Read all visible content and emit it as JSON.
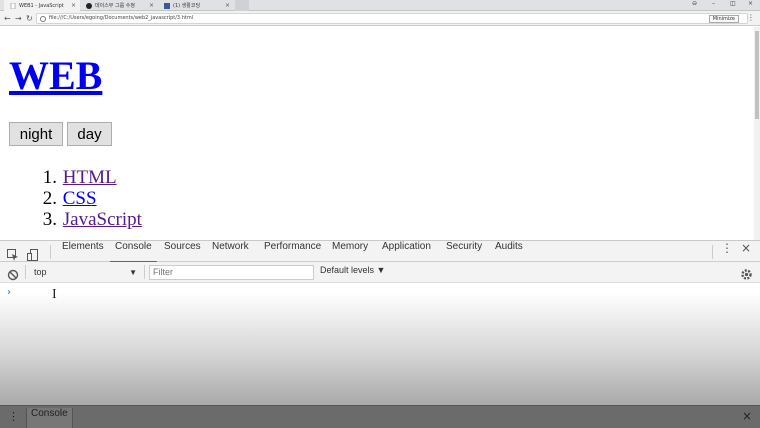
{
  "browser": {
    "tabs": [
      {
        "title": "WEB1 - JavaScript",
        "active": true
      },
      {
        "title": "데이스부 그룹 수정",
        "active": false
      },
      {
        "title": "(1) 생활코딩",
        "active": false
      },
      {
        "title": "",
        "active": false
      }
    ],
    "tab_close": "×",
    "window_controls": {
      "user": "⊖",
      "minimize": "–",
      "maximize": "◫",
      "close": "×"
    },
    "nav": {
      "back": "←",
      "forward": "→",
      "reload": "↻"
    },
    "url": "file:///C:/Users/egoing/Documents/web2_javascript/3.html",
    "zoom_chip": "Minimize",
    "menu": "⋮"
  },
  "page": {
    "title": "WEB",
    "buttons": {
      "night": "night",
      "day": "day"
    },
    "list": [
      {
        "num": "1.",
        "label": "HTML",
        "visited": true
      },
      {
        "num": "2.",
        "label": "CSS",
        "visited": false
      },
      {
        "num": "3.",
        "label": "JavaScript",
        "visited": true
      }
    ]
  },
  "devtools": {
    "tabs": [
      "Elements",
      "Console",
      "Sources",
      "Network",
      "Performance",
      "Memory",
      "Application",
      "Security",
      "Audits"
    ],
    "active_tab": "Console",
    "more": "⋮",
    "close": "×",
    "toolbar": {
      "context": "top",
      "context_arrow": "▼",
      "filter_placeholder": "Filter",
      "levels": "Default levels ▼"
    },
    "console": {
      "prompt": "›",
      "cursor": "I"
    },
    "drawer": {
      "menu": "⋮",
      "tab": "Console",
      "close": "×"
    }
  },
  "colors": {
    "link": "#0000ee",
    "visited_link": "#551a8b",
    "active_tab_underline": "#1a73e8",
    "prompt": "#4a8ae8"
  }
}
